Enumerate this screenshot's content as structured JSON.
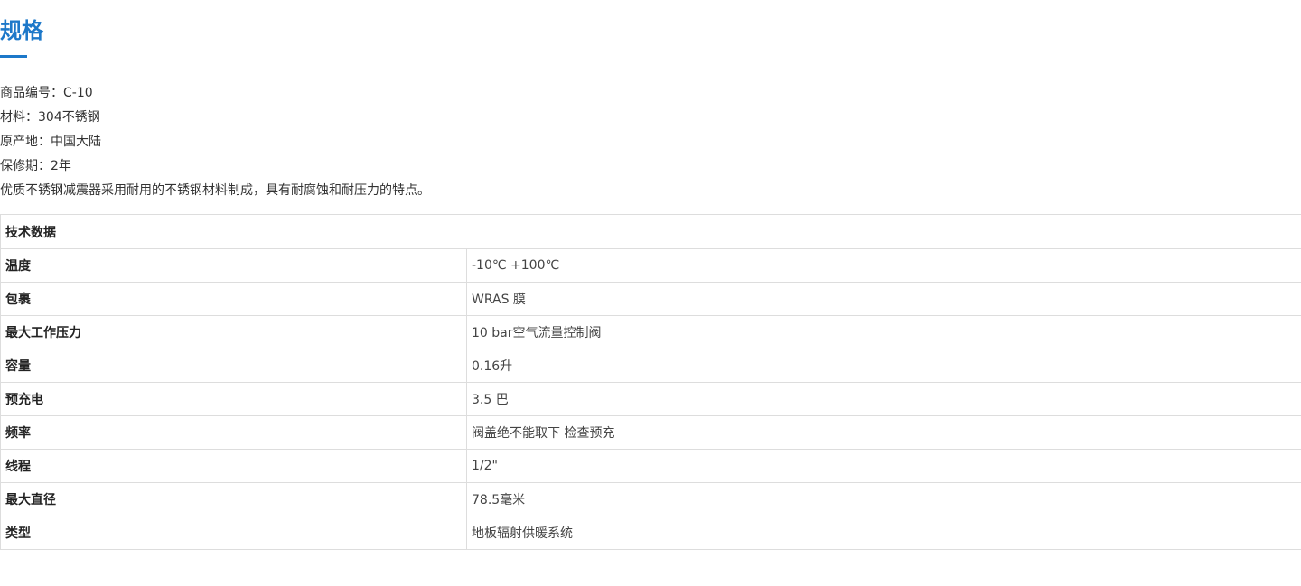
{
  "section": {
    "title": "规格",
    "accent_color": "#1d78c9"
  },
  "info_lines": [
    "商品编号：C-10",
    "材料：304不锈钢",
    "原产地：中国大陆",
    "保修期：2年",
    "优质不锈钢减震器采用耐用的不锈钢材料制成，具有耐腐蚀和耐压力的特点。"
  ],
  "table": {
    "header": "技术数据",
    "rows": [
      {
        "label": "温度",
        "value": "-10℃ +100℃"
      },
      {
        "label": "包裹",
        "value": "WRAS 膜"
      },
      {
        "label": "最大工作压力",
        "value": "10 bar空气流量控制阀"
      },
      {
        "label": "容量",
        "value": "0.16升"
      },
      {
        "label": "预充电",
        "value": "3.5 巴"
      },
      {
        "label": "频率",
        "value": "阀盖绝不能取下 检查预充"
      },
      {
        "label": "线程",
        "value": "1/2\""
      },
      {
        "label": "最大直径",
        "value": "78.5毫米"
      },
      {
        "label": "类型",
        "value": "地板辐射供暖系统"
      }
    ]
  }
}
